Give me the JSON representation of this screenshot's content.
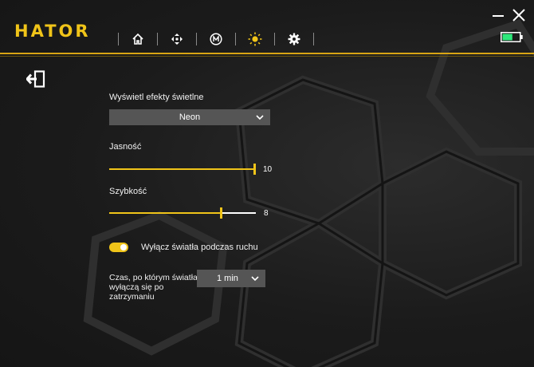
{
  "app": {
    "logo_text": "HATOR",
    "accent": "#f0c419"
  },
  "nav": [
    {
      "icon": "home-icon"
    },
    {
      "icon": "dpad-icon"
    },
    {
      "icon": "macro-m-icon"
    },
    {
      "icon": "sun-lighting-icon",
      "active": true
    },
    {
      "icon": "gear-icon"
    }
  ],
  "window": {
    "minimize_icon": "minimize-icon",
    "close_icon": "close-icon",
    "battery_icon": "battery-icon",
    "battery_level": 0.6
  },
  "lighting": {
    "effects_label": "Wyświetl efekty świetlne",
    "effect_value": "Neon",
    "brightness_label": "Jasność",
    "brightness_value": "10",
    "brightness_fraction": 1.0,
    "speed_label": "Szybkość",
    "speed_value": "8",
    "speed_fraction": 0.77,
    "motion_toggle_label": "Wyłącz światła podczas ruchu",
    "motion_toggle_on": true,
    "timeout_label_line1": "Czas, po którym światła",
    "timeout_label_line2": "wyłączą się po",
    "timeout_label_line3": "zatrzymaniu",
    "timeout_value": "1 min"
  }
}
